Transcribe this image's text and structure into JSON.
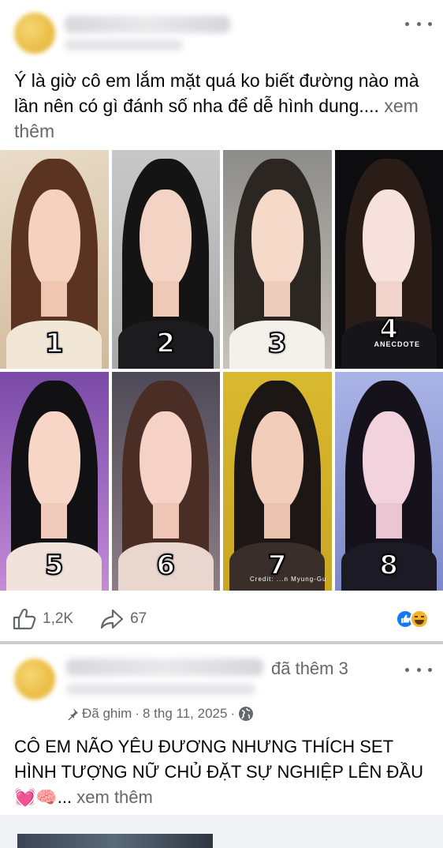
{
  "post1": {
    "caption": "Ý là giờ cô em lắm mặt quá ko biết đường nào mà lần nên có gì đánh số nha để dễ hình dung....",
    "see_more": "xem thêm",
    "photos": [
      {
        "label": "1"
      },
      {
        "label": "2"
      },
      {
        "label": "3"
      },
      {
        "label": "4",
        "watermark": "ANECDOTE"
      },
      {
        "label": "5"
      },
      {
        "label": "6"
      },
      {
        "label": "7",
        "watermark": "Credit: ...n Myung-Gu"
      },
      {
        "label": "8"
      }
    ],
    "likes": "1,2K",
    "shares": "67",
    "reaction_icons": [
      "like-icon",
      "haha-icon"
    ]
  },
  "post2": {
    "added_text": "đã thêm 3",
    "pinned_label": "Đã ghim",
    "date": "8 thg 11, 2025",
    "caption": "CÔ EM NÃO YÊU ĐƯƠNG NHƯNG THÍCH SET HÌNH TƯỢNG NỮ CHỦ ĐẶT SỰ NGHIỆP LÊN ĐẦU",
    "caption_emojis": "💓🧠",
    "see_more": "xem thêm"
  },
  "colors": {
    "text": "#050505",
    "secondary": "#65676b",
    "like_blue": "#1877f2",
    "haha_yellow": "#f7b125"
  }
}
